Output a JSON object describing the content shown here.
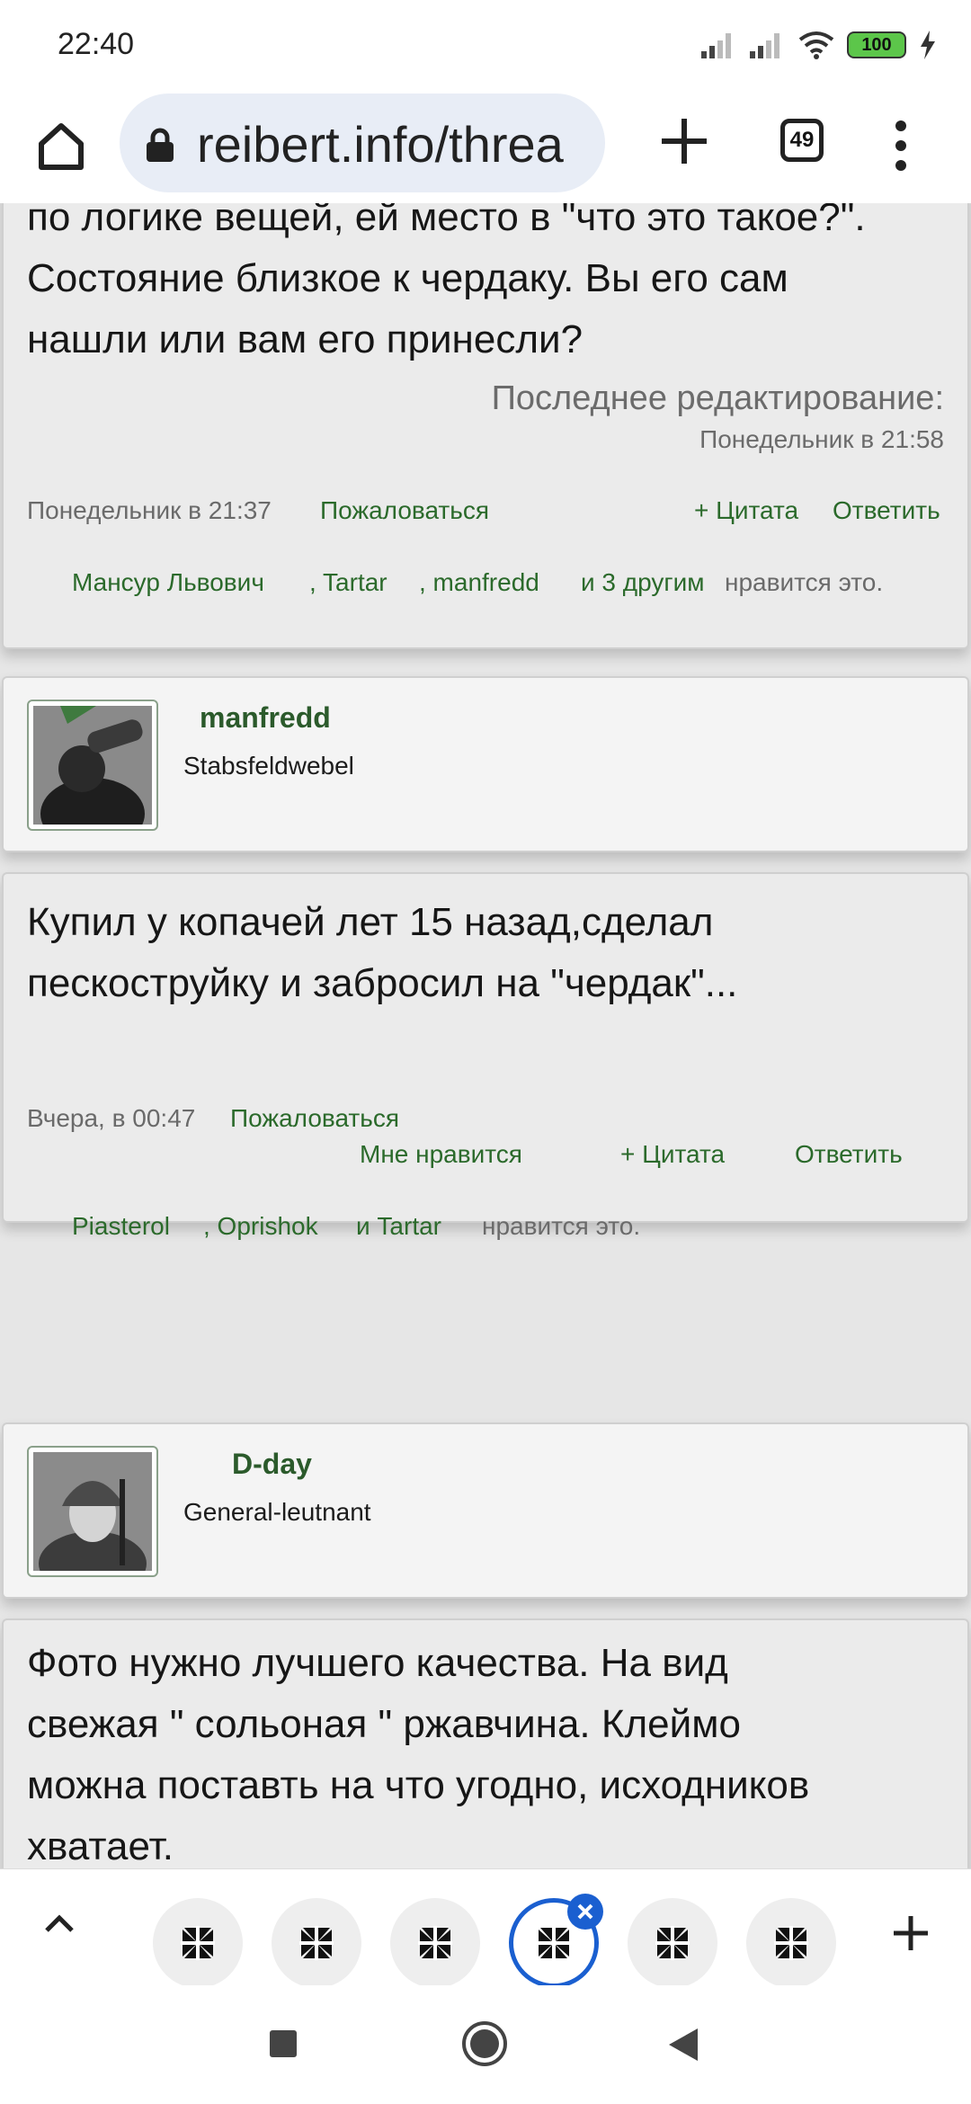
{
  "status": {
    "time": "22:40",
    "battery": "100",
    "icons": [
      "signal-icon",
      "signal-icon",
      "wifi-icon",
      "battery-icon",
      "charging-icon"
    ]
  },
  "browser": {
    "url": "reibert.info/threa",
    "tab_count": "49",
    "icons": [
      "home-icon",
      "lock-icon",
      "plus-icon",
      "menu-icon"
    ]
  },
  "posts": [
    {
      "text_lines": [
        "по логике вещей, ей место в \"что это такое?\".",
        "Состояние близкое к чердаку. Вы его сам",
        "нашли или вам его принесли?"
      ],
      "edited_label": "Последнее редактирование:",
      "edited_time": "Понедельник в 21:58",
      "date": "Понедельник в 21:37",
      "report": "Пожаловаться",
      "quote": "+ Цитата",
      "reply": "Ответить",
      "likes": {
        "user1": "Мансур Львович",
        "user2": ", Tartar",
        "user3": ", manfredd",
        "others": "и 3 другим",
        "suffix": "нравится это."
      }
    },
    {
      "author": "manfredd",
      "rank": "Stabsfeldwebel",
      "text_lines": [
        "Купил у копачей лет 15 назад,сделал",
        "пескоструйку и забросил на \"чердак\"..."
      ],
      "date": "Вчера, в 00:47",
      "report": "Пожаловаться",
      "like": "Мне нравится",
      "quote": "+ Цитата",
      "reply": "Ответить",
      "likes": {
        "user1": "Piasterol",
        "user2": ", Oprishok",
        "user3": "и Tartar",
        "suffix": "нравится это."
      }
    },
    {
      "author": "D-day",
      "rank": "General-leutnant",
      "text_lines": [
        "Фото нужно лучшего качества. На вид",
        "свежая \" сольоная \" ржавчина. Клеймо",
        "можна поставть на что угодно, исходников",
        "хватает."
      ]
    }
  ],
  "tab_strip": {
    "tab_icon": "iron-cross-icon",
    "tabs": 6,
    "active_index": 3
  },
  "colors": {
    "link_green": "#2b6a2b",
    "accent_blue": "#1a5fd0",
    "username_green": "#2b5a2b"
  }
}
